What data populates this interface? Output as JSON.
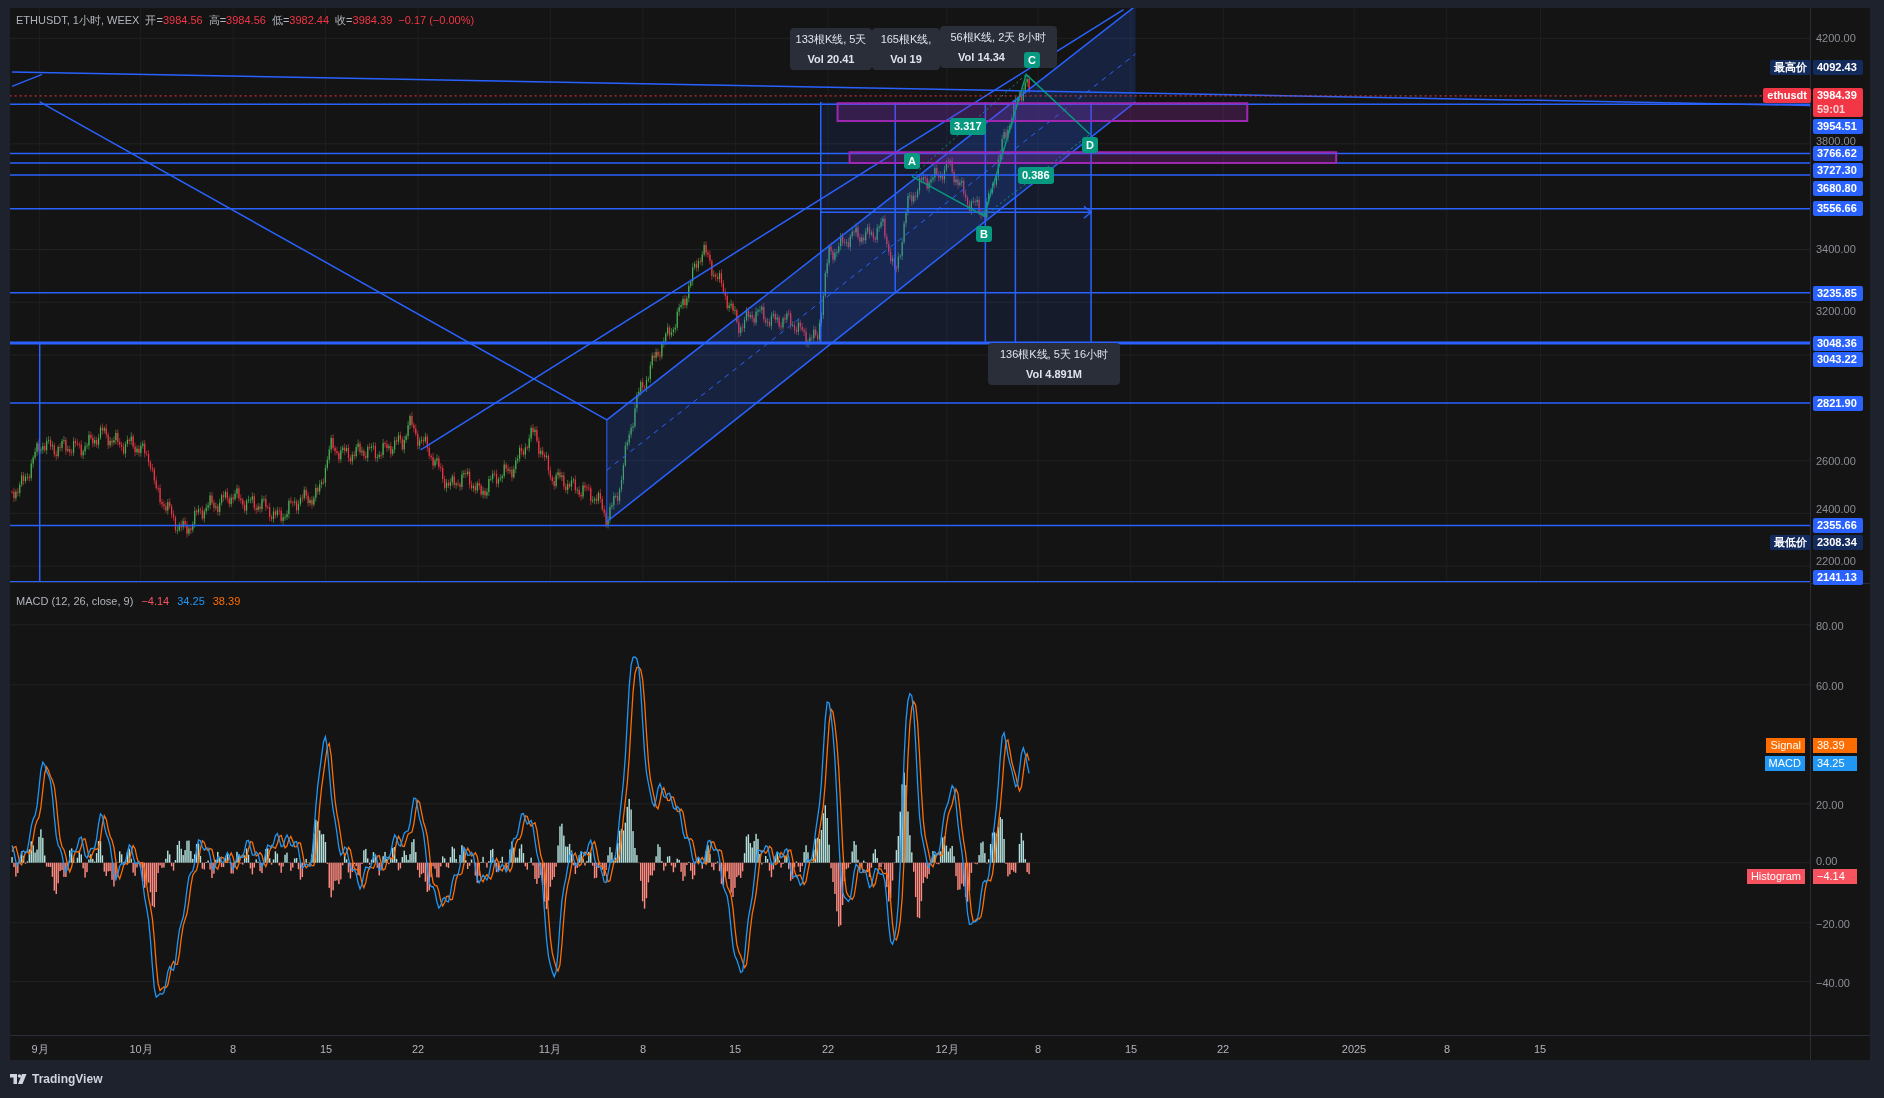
{
  "header": {
    "symbol": "ETHUSDT, 1小时, WEEX",
    "ohlc": [
      {
        "label": "开=",
        "value": "3984.56"
      },
      {
        "label": "高=",
        "value": "3984.56"
      },
      {
        "label": "低=",
        "value": "3982.44"
      },
      {
        "label": "收=",
        "value": "3984.39"
      }
    ],
    "change": "−0.17 (−0.00%)"
  },
  "price_axis": {
    "ticks": [
      "4200.00",
      "3800.00",
      "3400.00",
      "3200.00",
      "2600.00",
      "2400.00",
      "2200.00"
    ],
    "labels": [
      {
        "kind": "extreme",
        "tag": "最高价",
        "value": "4092.43"
      },
      {
        "kind": "last",
        "tag": "ethusdt",
        "value": "3984.39",
        "countdown": "59:01"
      },
      {
        "kind": "line",
        "value": "3954.51"
      },
      {
        "kind": "line",
        "value": "3766.62"
      },
      {
        "kind": "line",
        "value": "3727.30"
      },
      {
        "kind": "line",
        "value": "3680.80"
      },
      {
        "kind": "line",
        "value": "3556.66"
      },
      {
        "kind": "line",
        "value": "3235.85"
      },
      {
        "kind": "line",
        "value": "3048.36"
      },
      {
        "kind": "line",
        "value": "3043.22"
      },
      {
        "kind": "line",
        "value": "2821.90"
      },
      {
        "kind": "line",
        "value": "2355.66"
      },
      {
        "kind": "extreme",
        "tag": "最低价",
        "value": "2308.34"
      },
      {
        "kind": "line",
        "value": "2141.13"
      }
    ]
  },
  "drawings": {
    "range_tooltips": [
      {
        "line1": "133根K线, 5天",
        "line2": "Vol 20.41"
      },
      {
        "line1": "165根K线,",
        "line2": "Vol 19"
      },
      {
        "line1": "56根K线, 2天 8小时",
        "line2": "Vol 14.34"
      },
      {
        "line1": "136根K线, 5天 16小时",
        "line2": "Vol 4.891M"
      }
    ],
    "pattern_points": [
      "A",
      "B",
      "C",
      "D"
    ],
    "ratios": [
      "3.317",
      "0.386"
    ]
  },
  "macd": {
    "legend": "MACD (12, 26, close, 9)",
    "values": [
      {
        "kind": "histogram",
        "value": "−4.14"
      },
      {
        "kind": "macd",
        "value": "34.25"
      },
      {
        "kind": "signal",
        "value": "38.39"
      }
    ],
    "ticks": [
      "80.00",
      "60.00",
      "20.00",
      "0.00",
      "−20.00",
      "−40.00"
    ],
    "labels": [
      {
        "kind": "signal",
        "tag": "Signal",
        "value": "38.39"
      },
      {
        "kind": "macd",
        "tag": "MACD",
        "value": "34.25"
      },
      {
        "kind": "histogram",
        "tag": "Histogram",
        "value": "−4.14"
      }
    ]
  },
  "time_axis": [
    "9月",
    "10月",
    "8",
    "15",
    "22",
    "11月",
    "8",
    "15",
    "22",
    "12月",
    "8",
    "15",
    "22",
    "2025",
    "8",
    "15"
  ],
  "footer": {
    "brand": "TradingView"
  }
}
